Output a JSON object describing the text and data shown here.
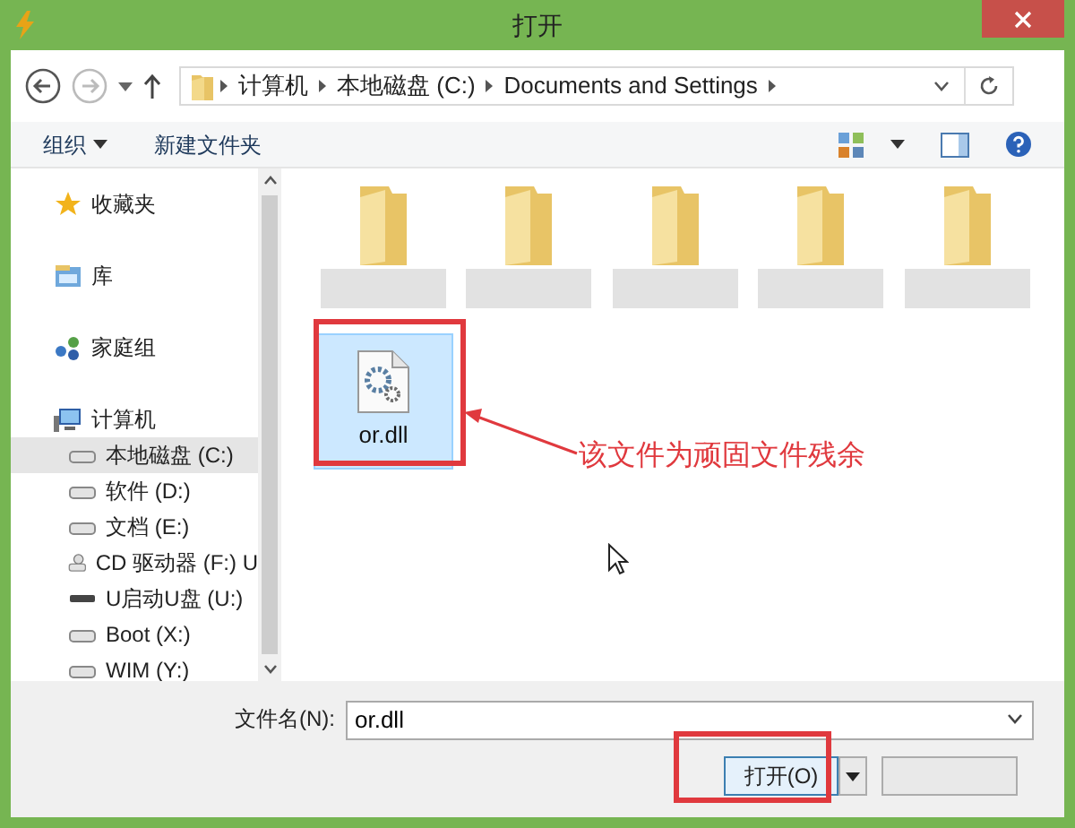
{
  "window": {
    "title": "打开"
  },
  "address": {
    "path": [
      "计算机",
      "本地磁盘 (C:)",
      "Documents and Settings"
    ]
  },
  "toolbar": {
    "organize": "组织",
    "new_folder": "新建文件夹"
  },
  "sidebar": {
    "items": [
      {
        "label": "收藏夹",
        "kind": "favorites",
        "selected": false
      },
      {
        "label": "库",
        "kind": "library",
        "selected": false
      },
      {
        "label": "家庭组",
        "kind": "homegroup",
        "selected": false
      },
      {
        "label": "计算机",
        "kind": "computer",
        "selected": false,
        "children": [
          {
            "label": "本地磁盘 (C:)",
            "kind": "disk",
            "selected": true
          },
          {
            "label": "软件 (D:)",
            "kind": "disk",
            "selected": false
          },
          {
            "label": "文档 (E:)",
            "kind": "disk",
            "selected": false
          },
          {
            "label": "CD 驱动器 (F:) U",
            "kind": "cd",
            "selected": false
          },
          {
            "label": "U启动U盘 (U:)",
            "kind": "usb",
            "selected": false
          },
          {
            "label": "Boot (X:)",
            "kind": "disk",
            "selected": false
          },
          {
            "label": "WIM (Y:)",
            "kind": "disk",
            "selected": false
          }
        ]
      }
    ]
  },
  "files": [
    {
      "kind": "folder",
      "selected": false
    },
    {
      "kind": "folder",
      "selected": false
    },
    {
      "kind": "folder",
      "selected": false
    },
    {
      "kind": "folder",
      "selected": false
    },
    {
      "kind": "folder",
      "selected": false
    },
    {
      "kind": "file",
      "label": "or.dll",
      "selected": true
    }
  ],
  "annotation": {
    "text": "该文件为顽固文件残余"
  },
  "filename": {
    "label": "文件名(N):",
    "value": "or.dll"
  },
  "buttons": {
    "open": "打开(O)"
  }
}
